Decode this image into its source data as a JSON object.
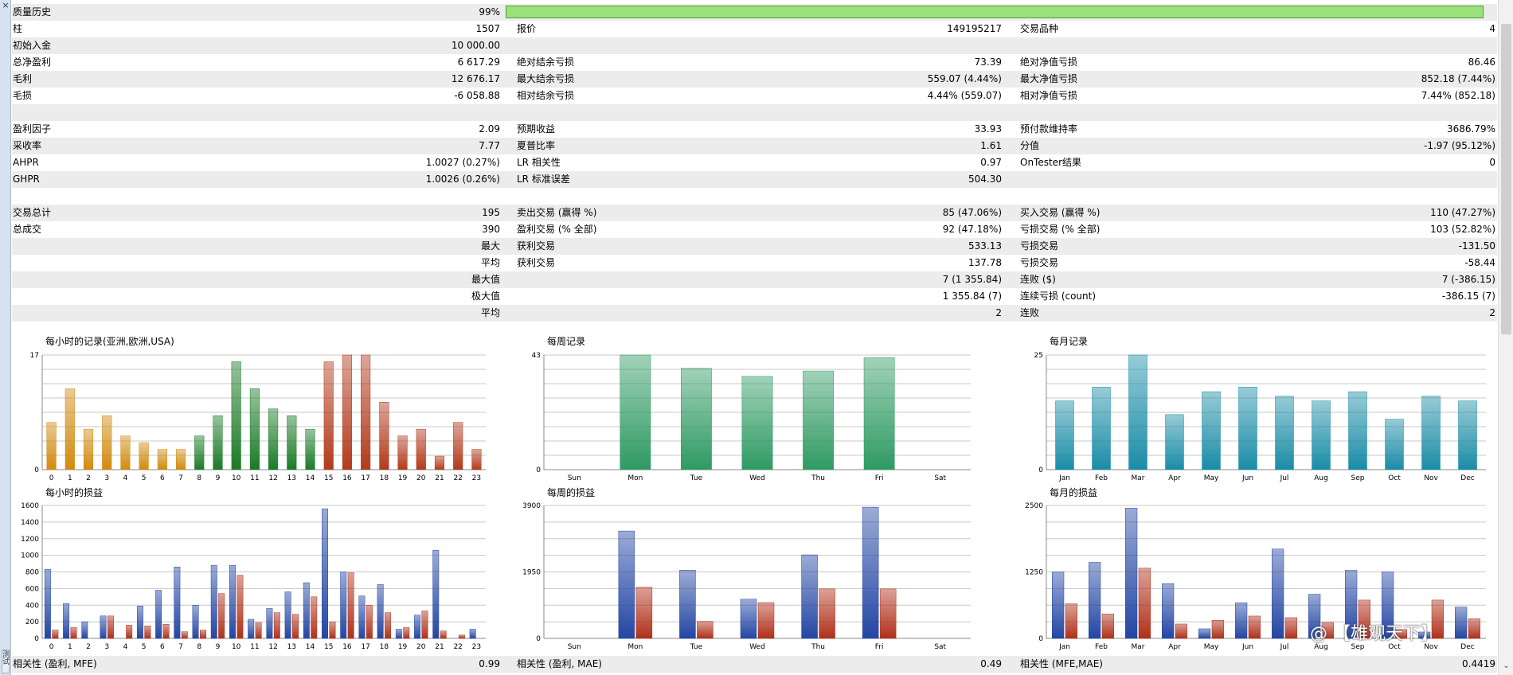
{
  "side_panel": {
    "close_glyph": "×",
    "tab_label": "测试"
  },
  "scrollbar": {
    "down_glyph": "⌄"
  },
  "report_rows": [
    {
      "shade": true,
      "cells": [
        {
          "t": "质量历史"
        },
        {
          "t": "99%",
          "r": true
        }
      ]
    },
    {
      "shade": false,
      "cells": [
        {
          "t": "柱"
        },
        {
          "t": "1507",
          "r": true
        },
        {
          "t": "报价"
        },
        {
          "t": "149195217",
          "r": true
        },
        {
          "t": "交易品种"
        },
        {
          "t": "4",
          "r": true
        }
      ]
    },
    {
      "shade": true,
      "cells": [
        {
          "t": "初始入金"
        },
        {
          "t": "10 000.00",
          "r": true
        }
      ]
    },
    {
      "shade": false,
      "cells": [
        {
          "t": "总净盈利"
        },
        {
          "t": "6 617.29",
          "r": true
        },
        {
          "t": "绝对结余亏损"
        },
        {
          "t": "73.39",
          "r": true
        },
        {
          "t": "绝对净值亏损"
        },
        {
          "t": "86.46",
          "r": true
        }
      ]
    },
    {
      "shade": true,
      "cells": [
        {
          "t": "毛利"
        },
        {
          "t": "12 676.17",
          "r": true
        },
        {
          "t": "最大结余亏损"
        },
        {
          "t": "559.07 (4.44%)",
          "r": true
        },
        {
          "t": "最大净值亏损"
        },
        {
          "t": "852.18 (7.44%)",
          "r": true
        }
      ]
    },
    {
      "shade": false,
      "cells": [
        {
          "t": "毛损"
        },
        {
          "t": "-6 058.88",
          "r": true
        },
        {
          "t": "相对结余亏损"
        },
        {
          "t": "4.44% (559.07)",
          "r": true
        },
        {
          "t": "相对净值亏损"
        },
        {
          "t": "7.44% (852.18)",
          "r": true
        }
      ]
    },
    {
      "shade": true,
      "cells": []
    },
    {
      "shade": false,
      "cells": [
        {
          "t": "盈利因子"
        },
        {
          "t": "2.09",
          "r": true
        },
        {
          "t": "预期收益"
        },
        {
          "t": "33.93",
          "r": true
        },
        {
          "t": "预付款维持率"
        },
        {
          "t": "3686.79%",
          "r": true
        }
      ]
    },
    {
      "shade": true,
      "cells": [
        {
          "t": "采收率"
        },
        {
          "t": "7.77",
          "r": true
        },
        {
          "t": "夏普比率"
        },
        {
          "t": "1.61",
          "r": true
        },
        {
          "t": "分值"
        },
        {
          "t": "-1.97 (95.12%)",
          "r": true
        }
      ]
    },
    {
      "shade": false,
      "cells": [
        {
          "t": "AHPR"
        },
        {
          "t": "1.0027 (0.27%)",
          "r": true
        },
        {
          "t": "LR 相关性"
        },
        {
          "t": "0.97",
          "r": true
        },
        {
          "t": "OnTester结果"
        },
        {
          "t": "0",
          "r": true
        }
      ]
    },
    {
      "shade": true,
      "cells": [
        {
          "t": "GHPR"
        },
        {
          "t": "1.0026 (0.26%)",
          "r": true
        },
        {
          "t": "LR 标准误差"
        },
        {
          "t": "504.30",
          "r": true
        }
      ]
    },
    {
      "shade": false,
      "cells": []
    },
    {
      "shade": true,
      "cells": [
        {
          "t": "交易总计"
        },
        {
          "t": "195",
          "r": true
        },
        {
          "t": "卖出交易 (赢得 %)"
        },
        {
          "t": "85 (47.06%)",
          "r": true
        },
        {
          "t": "买入交易 (赢得 %)"
        },
        {
          "t": "110 (47.27%)",
          "r": true
        }
      ]
    },
    {
      "shade": false,
      "cells": [
        {
          "t": "总成交"
        },
        {
          "t": "390",
          "r": true
        },
        {
          "t": "盈利交易 (% 全部)"
        },
        {
          "t": "92 (47.18%)",
          "r": true
        },
        {
          "t": "亏损交易 (% 全部)"
        },
        {
          "t": "103 (52.82%)",
          "r": true
        }
      ]
    },
    {
      "shade": true,
      "cells": [
        {
          "t": ""
        },
        {
          "t": "最大",
          "r": true
        },
        {
          "t": "获利交易"
        },
        {
          "t": "533.13",
          "r": true
        },
        {
          "t": "亏损交易"
        },
        {
          "t": "-131.50",
          "r": true
        }
      ]
    },
    {
      "shade": false,
      "cells": [
        {
          "t": ""
        },
        {
          "t": "平均",
          "r": true
        },
        {
          "t": "获利交易"
        },
        {
          "t": "137.78",
          "r": true
        },
        {
          "t": "亏损交易"
        },
        {
          "t": "-58.44",
          "r": true
        }
      ]
    },
    {
      "shade": true,
      "cells": [
        {
          "t": ""
        },
        {
          "t": "最大值",
          "r": true
        },
        {
          "t": ""
        },
        {
          "t": "7 (1 355.84)",
          "r": true
        },
        {
          "t": "连败 ($)"
        },
        {
          "t": "7 (-386.15)",
          "r": true
        }
      ]
    },
    {
      "shade": false,
      "cells": [
        {
          "t": ""
        },
        {
          "t": "极大值",
          "r": true
        },
        {
          "t": ""
        },
        {
          "t": "1 355.84 (7)",
          "r": true
        },
        {
          "t": "连续亏损 (count)"
        },
        {
          "t": "-386.15 (7)",
          "r": true
        }
      ]
    },
    {
      "shade": true,
      "cells": [
        {
          "t": ""
        },
        {
          "t": "平均",
          "r": true
        },
        {
          "t": ""
        },
        {
          "t": "2",
          "r": true
        },
        {
          "t": "连败"
        },
        {
          "t": "2",
          "r": true
        }
      ]
    }
  ],
  "footer_row": {
    "cells": [
      {
        "t": "相关性 (盈利, MFE)"
      },
      {
        "t": "0.99",
        "r": true
      },
      {
        "t": "相关性 (盈利, MAE)"
      },
      {
        "t": "0.49",
        "r": true
      },
      {
        "t": "相关性 (MFE,MAE)"
      },
      {
        "t": "0.4419",
        "r": true
      }
    ]
  },
  "watermark": {
    "text": "@ 【雄观天下】"
  },
  "colors": {
    "orange": "#d18a0e",
    "green": "#1a7a26",
    "red": "#b23a1c",
    "mint": "#2f9a63",
    "teal": "#1a8ca6",
    "blue": "#2346a4",
    "loss_red": "#b0301a"
  },
  "chart_data": [
    {
      "id": "hourly-records",
      "type": "bar",
      "title": "每小时的记录(亚洲,欧洲,USA)",
      "categories": [
        "0",
        "1",
        "2",
        "3",
        "4",
        "5",
        "6",
        "7",
        "8",
        "9",
        "10",
        "11",
        "12",
        "13",
        "14",
        "15",
        "16",
        "17",
        "18",
        "19",
        "20",
        "21",
        "22",
        "23"
      ],
      "values": [
        7,
        12,
        6,
        8,
        5,
        4,
        3,
        3,
        5,
        8,
        16,
        12,
        9,
        8,
        6,
        16,
        17,
        17,
        10,
        5,
        6,
        2,
        7,
        3
      ],
      "ylim": [
        0,
        17
      ],
      "yticks": [
        "0",
        "17"
      ],
      "bar_colors": [
        "orange",
        "orange",
        "orange",
        "orange",
        "orange",
        "orange",
        "orange",
        "orange",
        "green",
        "green",
        "green",
        "green",
        "green",
        "green",
        "green",
        "red",
        "red",
        "red",
        "red",
        "red",
        "red",
        "red",
        "red",
        "red"
      ]
    },
    {
      "id": "weekly-records",
      "type": "bar",
      "title": "每周记录",
      "categories": [
        "Sun",
        "Mon",
        "Tue",
        "Wed",
        "Thu",
        "Fri",
        "Sat"
      ],
      "values": [
        0,
        43,
        38,
        35,
        37,
        42,
        0
      ],
      "ylim": [
        0,
        43
      ],
      "yticks": [
        "0",
        "43"
      ],
      "color": "mint"
    },
    {
      "id": "monthly-records",
      "type": "bar",
      "title": "每月记录",
      "categories": [
        "Jan",
        "Feb",
        "Mar",
        "Apr",
        "May",
        "Jun",
        "Jul",
        "Aug",
        "Sep",
        "Oct",
        "Nov",
        "Dec"
      ],
      "values": [
        15,
        18,
        25,
        12,
        17,
        18,
        16,
        15,
        17,
        11,
        16,
        15
      ],
      "ylim": [
        0,
        25
      ],
      "yticks": [
        "0",
        "25"
      ],
      "color": "teal"
    },
    {
      "id": "hourly-pnl",
      "type": "bar",
      "title": "每小时的损益",
      "categories": [
        "0",
        "1",
        "2",
        "3",
        "4",
        "5",
        "6",
        "7",
        "8",
        "9",
        "10",
        "11",
        "12",
        "13",
        "14",
        "15",
        "16",
        "17",
        "18",
        "19",
        "20",
        "21",
        "22",
        "23"
      ],
      "series": [
        {
          "color": "blue",
          "values": [
            830,
            420,
            200,
            270,
            0,
            390,
            580,
            860,
            400,
            880,
            880,
            230,
            360,
            560,
            670,
            1560,
            800,
            510,
            650,
            110,
            280,
            1060,
            0,
            110
          ]
        },
        {
          "color": "loss_red",
          "values": [
            100,
            130,
            0,
            270,
            160,
            150,
            170,
            80,
            100,
            540,
            760,
            190,
            310,
            290,
            500,
            200,
            790,
            400,
            310,
            130,
            330,
            90,
            40,
            0
          ]
        }
      ],
      "ylim": [
        0,
        1600
      ],
      "yticks": [
        "0",
        "200",
        "400",
        "600",
        "800",
        "1000",
        "1200",
        "1400",
        "1600"
      ]
    },
    {
      "id": "weekly-pnl",
      "type": "bar",
      "title": "每周的损益",
      "categories": [
        "Sun",
        "Mon",
        "Tue",
        "Wed",
        "Thu",
        "Fri",
        "Sat"
      ],
      "series": [
        {
          "color": "blue",
          "values": [
            0,
            3150,
            2000,
            1150,
            2450,
            3850,
            0
          ]
        },
        {
          "color": "loss_red",
          "values": [
            0,
            1500,
            500,
            1050,
            1450,
            1450,
            0
          ]
        }
      ],
      "ylim": [
        0,
        3900
      ],
      "yticks": [
        "0",
        "1950",
        "3900"
      ]
    },
    {
      "id": "monthly-pnl",
      "type": "bar",
      "title": "每月的损益",
      "categories": [
        "Jan",
        "Feb",
        "Mar",
        "Apr",
        "May",
        "Jun",
        "Jul",
        "Aug",
        "Sep",
        "Oct",
        "Nov",
        "Dec"
      ],
      "series": [
        {
          "color": "blue",
          "values": [
            1250,
            1430,
            2450,
            1030,
            180,
            670,
            1680,
            830,
            1280,
            1250,
            120,
            590
          ]
        },
        {
          "color": "loss_red",
          "values": [
            650,
            460,
            1320,
            270,
            340,
            420,
            390,
            300,
            720,
            170,
            720,
            370
          ]
        }
      ],
      "ylim": [
        0,
        2500
      ],
      "yticks": [
        "0",
        "1250",
        "2500"
      ]
    }
  ]
}
